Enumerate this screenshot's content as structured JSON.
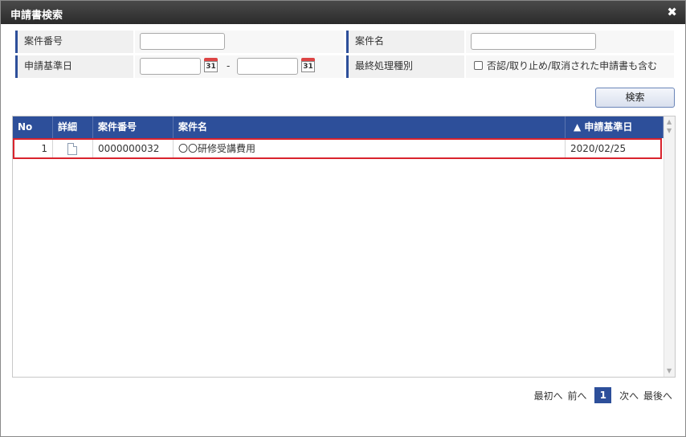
{
  "window": {
    "title": "申請書検索",
    "close_glyph": "✖"
  },
  "form": {
    "matter_no_label": "案件番号",
    "matter_name_label": "案件名",
    "base_date_label": "申請基準日",
    "calendar_day": "31",
    "date_separator": "-",
    "final_type_label": "最終処理種別",
    "include_label": "否認/取り止め/取消された申請書も含む"
  },
  "search_button": "検索",
  "grid": {
    "headers": [
      "No",
      "詳細",
      "案件番号",
      "案件名",
      "▲ 申請基準日"
    ],
    "rows": [
      {
        "no": "1",
        "matter_no": "0000000032",
        "matter_name": "〇〇研修受講費用",
        "base_date": "2020/02/25"
      }
    ]
  },
  "pager": {
    "first": "最初へ",
    "prev": "前へ",
    "current": "1",
    "next": "次へ",
    "last": "最後へ"
  },
  "colors": {
    "header_blue": "#2d4f9a",
    "highlight_red": "#d9232d",
    "titlebar_dark": "#2b2b2b"
  }
}
